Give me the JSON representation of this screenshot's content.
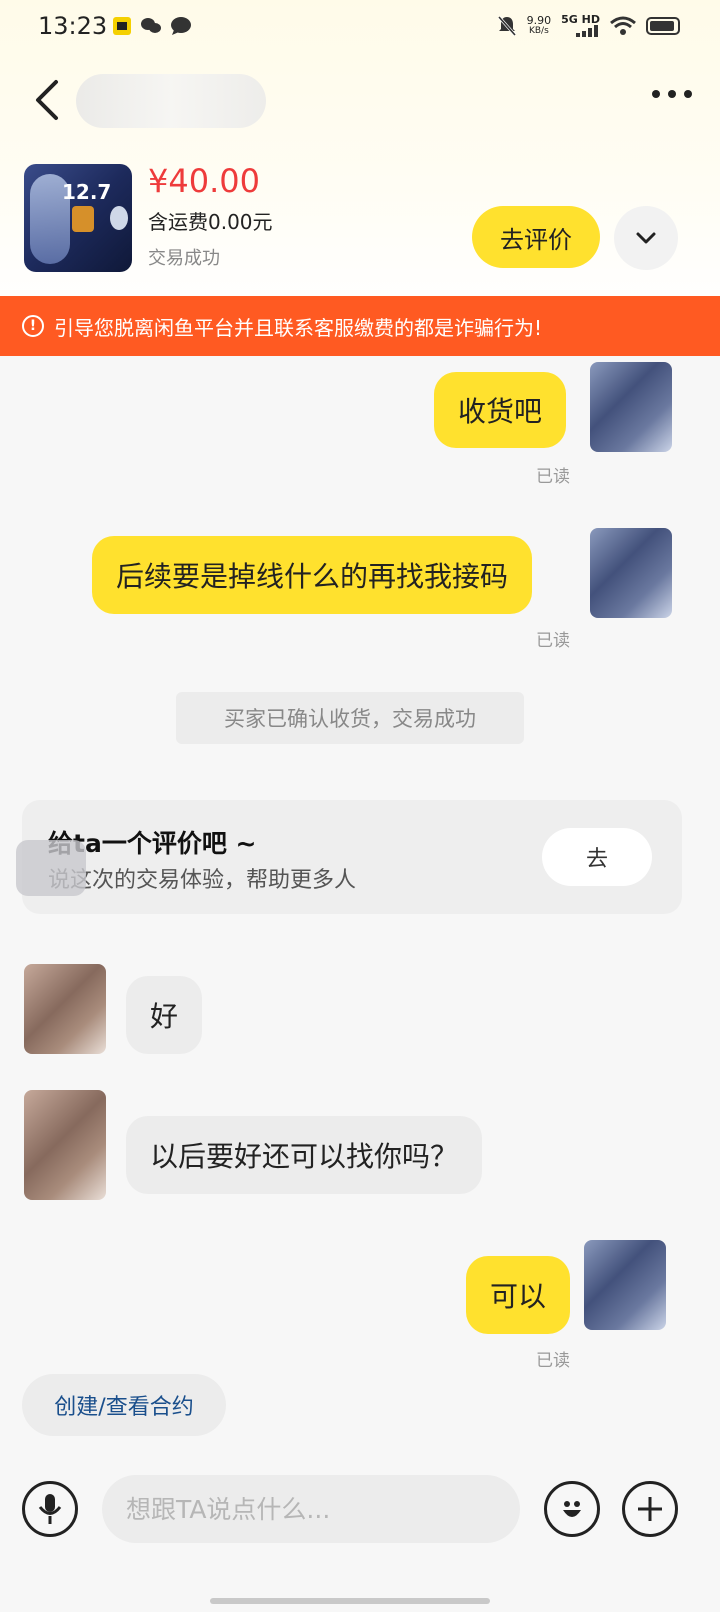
{
  "status_bar": {
    "time": "13:23",
    "speed_value": "9.90",
    "speed_unit": "KB/s",
    "network": "5G HD"
  },
  "nav": {
    "back_icon": "chevron-left-icon",
    "more_icon": "more-dots-icon"
  },
  "product": {
    "thumb_level": "12.7",
    "price": "¥40.00",
    "shipping": "含运费0.00元",
    "status": "交易成功",
    "review_button": "去评价"
  },
  "warning": {
    "icon": "!",
    "text": "引导您脱离闲鱼平台并且联系客服缴费的都是诈骗行为!"
  },
  "messages": [
    {
      "side": "me",
      "text": "收货吧",
      "read": "已读"
    },
    {
      "side": "me",
      "text": "后续要是掉线什么的再找我接码",
      "read": "已读"
    },
    {
      "side": "system",
      "text": "买家已确认收货，交易成功"
    },
    {
      "side": "them",
      "text": "好"
    },
    {
      "side": "them",
      "text": "以后要好还可以找你吗？"
    },
    {
      "side": "me",
      "text": "可以",
      "read": "已读"
    }
  ],
  "review_card": {
    "title": "给ta一个评价吧 ~",
    "subtitle": "说这次的交易体验，帮助更多人",
    "button": "去"
  },
  "contract_button": "创建/查看合约",
  "input": {
    "placeholder": "想跟TA说点什么..."
  },
  "colors": {
    "accent_yellow": "#ffe12e",
    "price_red": "#ee3b3b",
    "warning_orange": "#ff5a22",
    "link_blue": "#1a4f8c"
  }
}
